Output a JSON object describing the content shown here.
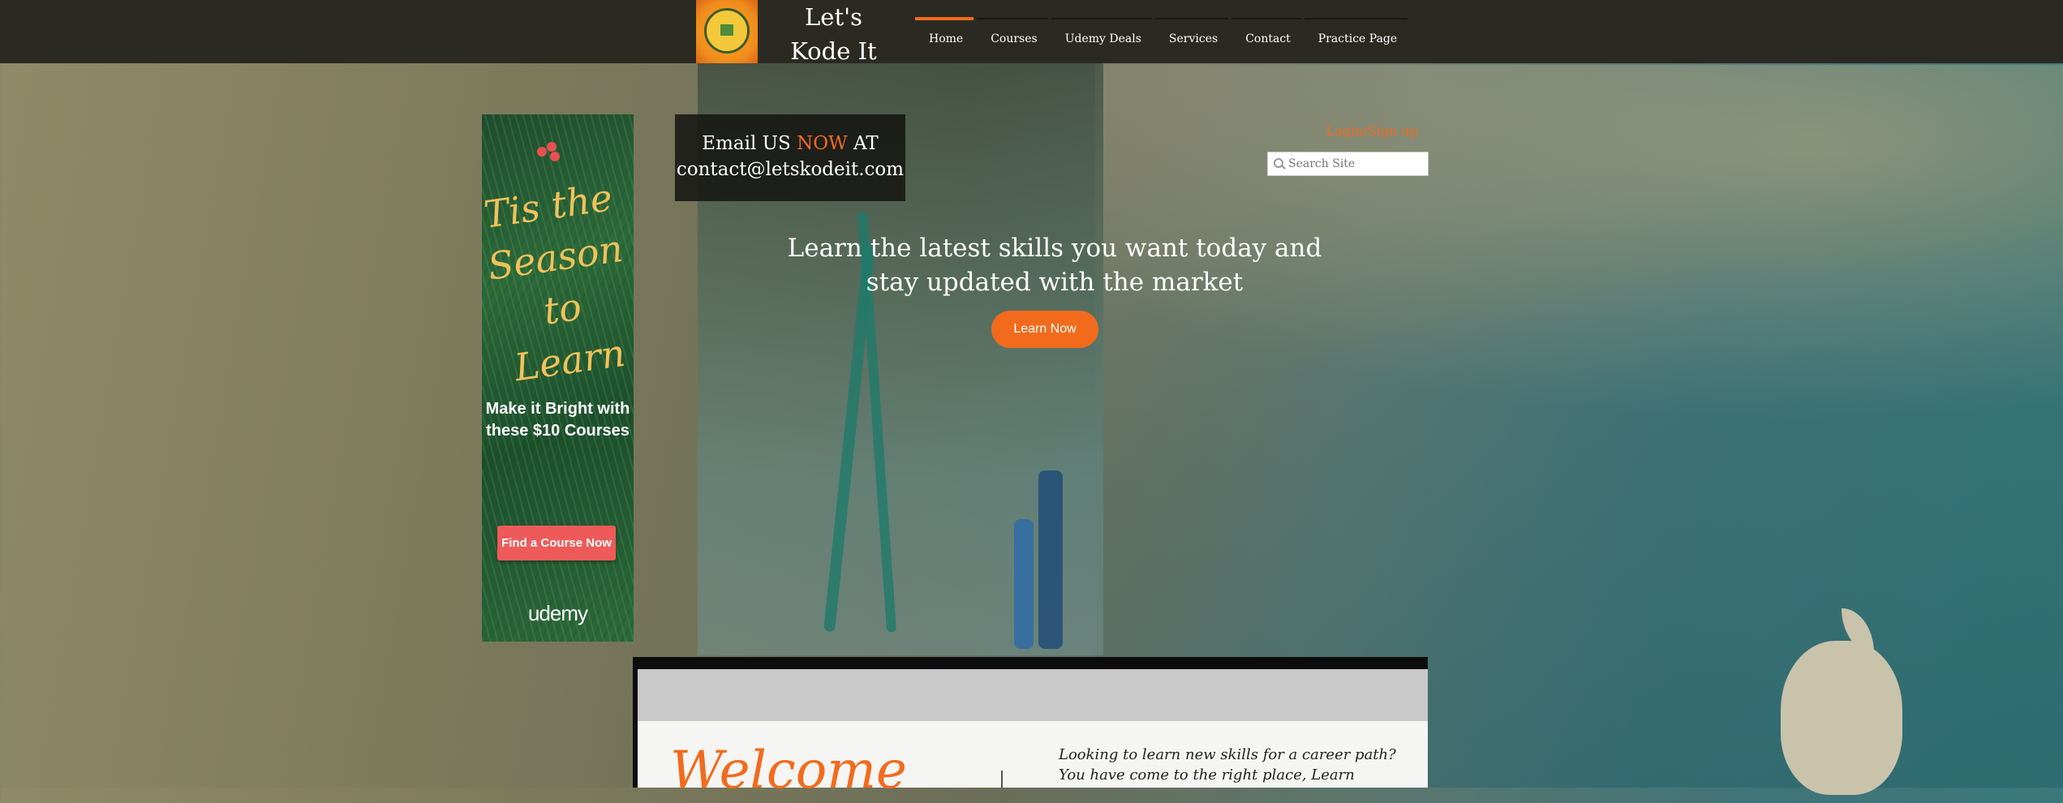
{
  "header": {
    "brand": "Let's Kode It",
    "nav": [
      {
        "label": "Home",
        "active": true
      },
      {
        "label": "Courses",
        "active": false
      },
      {
        "label": "Udemy Deals",
        "active": false
      },
      {
        "label": "Services",
        "active": false
      },
      {
        "label": "Contact",
        "active": false
      },
      {
        "label": "Practice Page",
        "active": false
      }
    ]
  },
  "banner": {
    "script_text": "Tis the Season to Learn",
    "copy": "Make it Bright with these $10 Courses",
    "button": "Find a Course Now",
    "logo": "udemy"
  },
  "email": {
    "line1_prefix": "Email US ",
    "line1_highlight": "NOW",
    "line1_suffix": " AT",
    "address": "contact@letskodeit.com"
  },
  "login": "Login/Sign up",
  "search": {
    "placeholder": "Search Site"
  },
  "hero": {
    "headline": "Learn the latest skills you want today and stay updated with the market",
    "cta": "Learn Now"
  },
  "welcome": {
    "title": "Welcome",
    "text_line1": "Looking to learn new skills for a career path?",
    "text_line2": "You have come to the right place, Learn"
  },
  "colors": {
    "accent": "#f26b1d",
    "topbar": "#2b2a22",
    "banner_button": "#ee5a5a"
  }
}
